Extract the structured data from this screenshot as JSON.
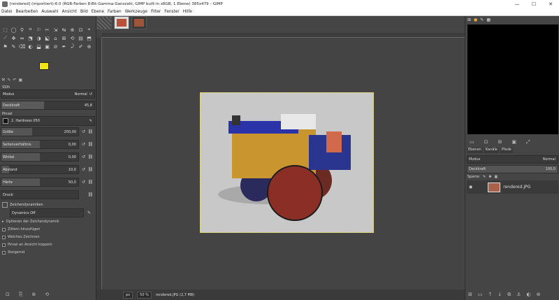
{
  "window": {
    "title": "[rendered] (importiert)-6.0 (RGB-Farben 8-Bit-Gamma-Ganzzahl, GIMP built-in sRGB, 1 Ebene) 385x479 – GIMP",
    "controls": [
      "—",
      "☐",
      "✕"
    ]
  },
  "menu": [
    "Datei",
    "Bearbeiten",
    "Auswahl",
    "Ansicht",
    "Bild",
    "Ebene",
    "Farben",
    "Werkzeuge",
    "Filter",
    "Fenster",
    "Hilfe"
  ],
  "tools": [
    "⬚",
    "◯",
    "⚲",
    "⌗",
    "⚐",
    "✂",
    "⇲",
    "⇆",
    "⊕",
    "⊡",
    "⌖",
    "⟋",
    "✥",
    "⇔",
    "⬔",
    "◑",
    "⬕",
    "⌂",
    "⊞",
    "⟲",
    "▤",
    "⬒",
    "⚑",
    "✎",
    "⌫",
    "◐",
    "⬓",
    "▣",
    "⊘",
    "✒",
    "⤸",
    "✐",
    "⊕"
  ],
  "tool_options": {
    "header": "SSIh",
    "mode_label": "Modus",
    "mode_value": "Normal",
    "opacity_label": "Deckkraft",
    "opacity_value": "45,8",
    "brush_label": "Pinsel",
    "brush_value": "2. Hardness 050",
    "size_label": "Größe",
    "size_value": "200,00",
    "aspect_label": "Seitenverhältnis",
    "aspect_value": "0,00",
    "angle_label": "Winkel",
    "angle_value": "0,00",
    "spacing_label": "Abstand",
    "spacing_value": "10,0",
    "hardness_label": "Härte",
    "hardness_value": "50,0",
    "pressure_label": "Druck",
    "dynamics_label": "Zeichendynamiken",
    "dynamics_value": "Dynamics Off",
    "dyn_options": "Optionen der Zeichendynamik",
    "checks": [
      "Zittern hinzufügen",
      "Weiches Zeichnen",
      "Pinsel an Ansicht koppeln",
      "Steigernd"
    ]
  },
  "status": {
    "unit": "px",
    "zoom": "50 %",
    "file": "rendered.JPG (2,7 MB)"
  },
  "right_panel": {
    "tabs": [
      "Ebenen",
      "Kanäle",
      "Pfade"
    ],
    "mode_label": "Modus",
    "mode_value": "Normal",
    "opacity_label": "Deckkraft",
    "opacity_value": "100,0",
    "lock_label": "Sperre:",
    "layer_name": "rendered.JPG"
  },
  "colors": {
    "foreground": "#f5e414",
    "background": "#ffffff"
  }
}
